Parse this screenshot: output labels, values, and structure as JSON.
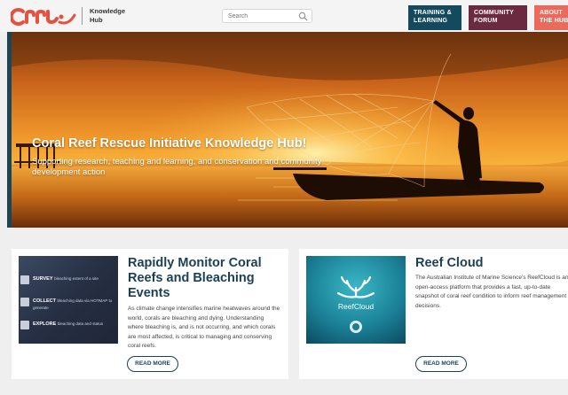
{
  "header": {
    "logo_alt": "CRRI",
    "logo_text": [
      "Knowledge",
      "Hub"
    ],
    "search_placeholder": "Search",
    "nav": [
      {
        "lines": [
          "TRAINING &",
          "LEARNING"
        ],
        "color": "#15495e"
      },
      {
        "lines": [
          "COMMUNITY",
          "FORUM"
        ],
        "color": "#6b2a40"
      },
      {
        "lines": [
          "ABOUT",
          "THE HUB"
        ],
        "color": "#eb6a5c"
      }
    ]
  },
  "hero": {
    "title": "Coral Reef Rescue Initiative Knowledge Hub!",
    "subtitle": "Supporting research, teaching and learning, and conservation and community development action"
  },
  "cards": [
    {
      "title": "Rapidly Monitor Coral Reefs and Bleaching Events",
      "body": "As climate change intensifies marine heatwaves around the world, corals are bleaching and dying. Understanding where bleaching is, and is not occurring, and which corals are most affected, is critical to managing and conserving coral reefs.",
      "button": "READ MORE",
      "thumb_rows": [
        {
          "head": "SURVEY",
          "text": "bleaching extent of a site"
        },
        {
          "head": "COLLECT",
          "text": "bleaching data via HOTMAP to generate"
        },
        {
          "head": "EXPLORE",
          "text": "bleaching data and status"
        }
      ]
    },
    {
      "title": "Reef Cloud",
      "body": "The Australian Institute of Marine Science's ReefCloud is an open-access platform that provides a fast, up-to-date snapshot of coral reef condition to inform reef management decisions.",
      "button": "READ MORE",
      "thumb_label": "ReefCloud"
    }
  ],
  "colors": {
    "brand_dark": "#1b3f55",
    "logo_red": "#e5513f",
    "page_bg": "#efefef"
  }
}
